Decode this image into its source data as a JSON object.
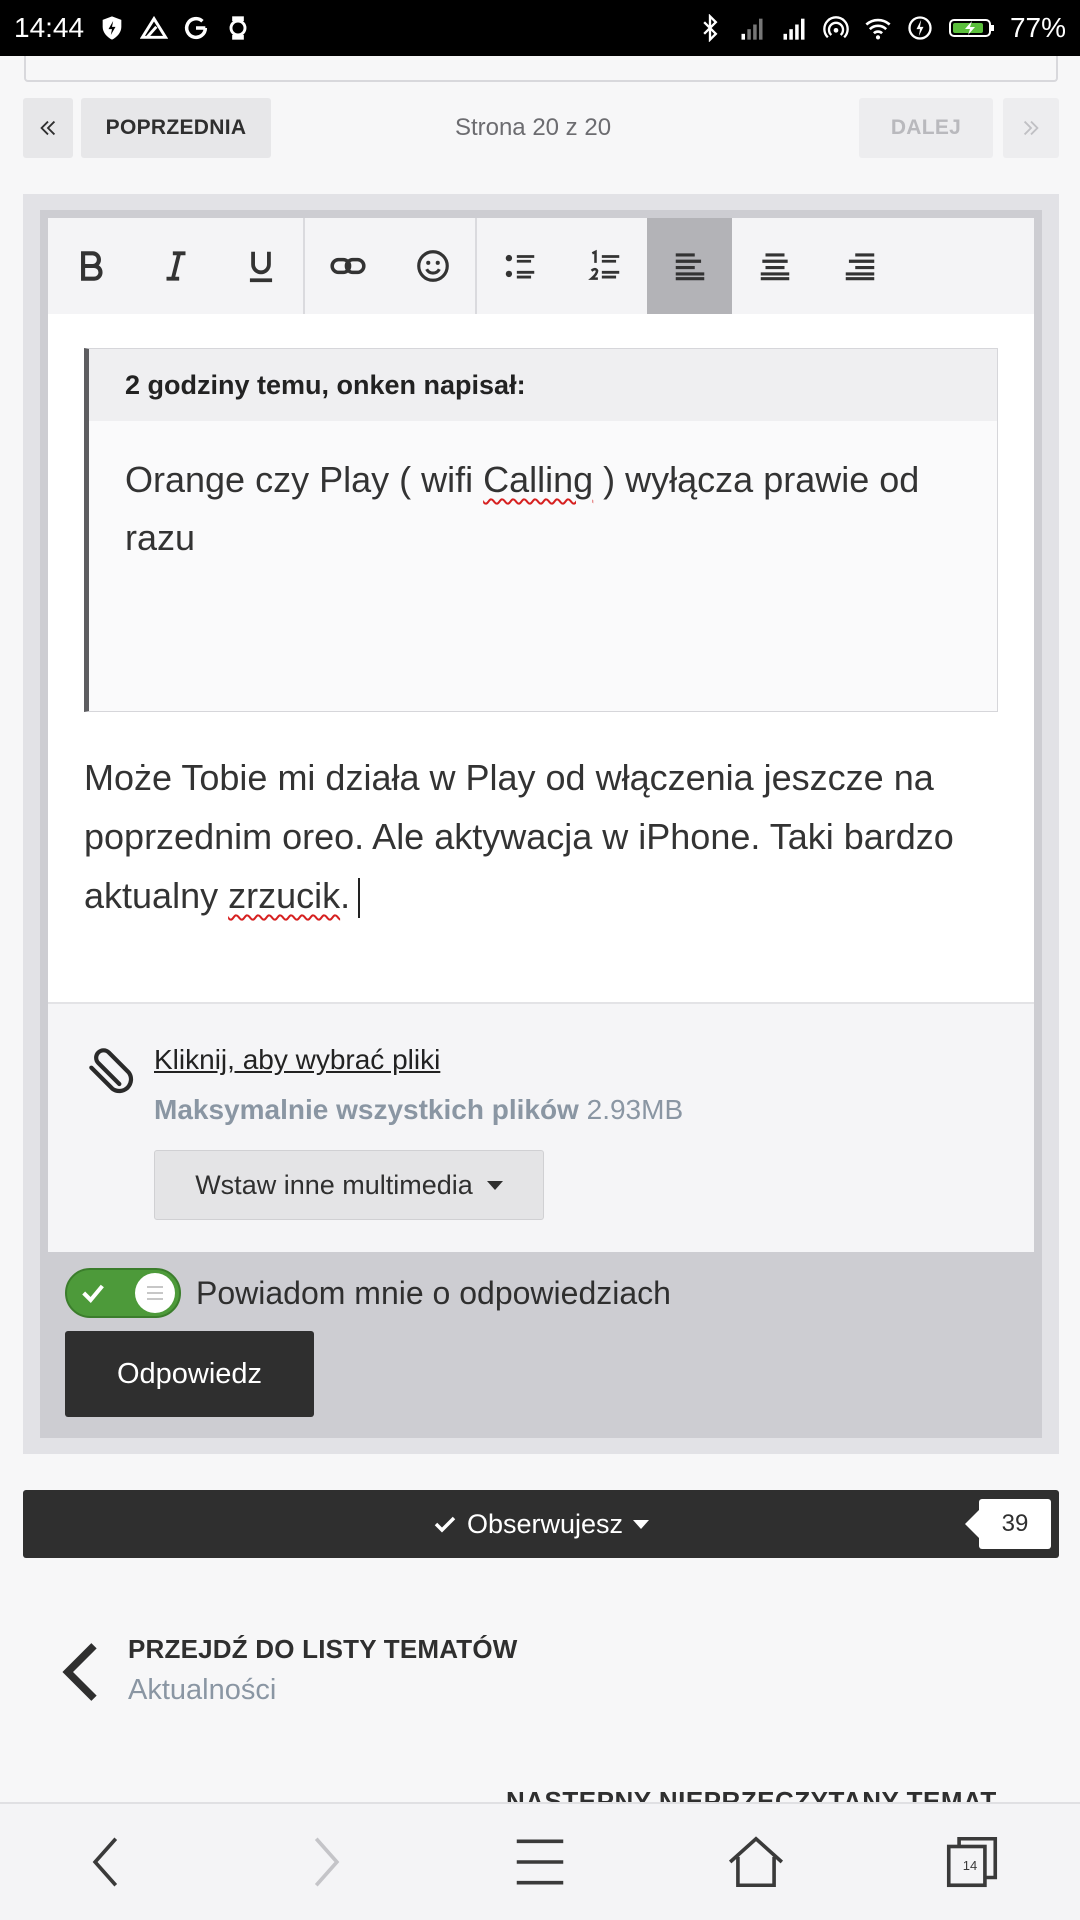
{
  "status_bar": {
    "time": "14:44",
    "battery": "77%"
  },
  "pagination": {
    "first_label": "«",
    "prev_label": "POPRZEDNIA",
    "page_label": "Strona 20 z 20",
    "next_label": "DALEJ",
    "last_label": "»"
  },
  "toolbar": {
    "buttons": [
      "bold",
      "italic",
      "underline",
      "link",
      "emoji",
      "bullet-list",
      "numbered-list",
      "align-left",
      "align-center",
      "align-right"
    ],
    "active": "align-left"
  },
  "quote": {
    "header": "2 godziny temu, onken napisał:",
    "text_before": "Orange czy Play ( wifi ",
    "text_misspelled": "Calling",
    "text_after": " ) wyłącza prawie od razu"
  },
  "reply": {
    "text_before": "Może Tobie mi działa w Play od włączenia jeszcze na poprzednim oreo. Ale aktywacja w iPhone. Taki bardzo aktualny ",
    "text_misspelled": "zrzucik",
    "text_after": "."
  },
  "attachments": {
    "choose_link": "Kliknij, aby wybrać pliki ",
    "max_label": "Maksymalnie wszystkich plików",
    "max_value": "2.93MB",
    "media_button": "Wstaw inne multimedia"
  },
  "notify": {
    "label": "Powiadom mnie o odpowiedziach",
    "enabled": true
  },
  "submit_label": "Odpowiedz",
  "follow": {
    "label": "Obserwujesz",
    "count": "39"
  },
  "back_to_list": {
    "title": "PRZEJDŹ DO LISTY TEMATÓW",
    "subtitle": "Aktualności"
  },
  "next_unread": "NASTĘPNY NIEPRZECZYTANY TEMAT",
  "browser_nav": {
    "tabs_count": "14"
  },
  "colors": {
    "accent_dark": "#2f2f2f",
    "toggle_on": "#4d9a3a",
    "muted_text": "#8a96a3"
  }
}
